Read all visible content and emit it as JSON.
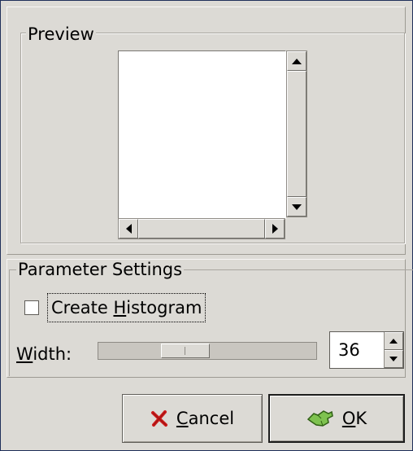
{
  "preview": {
    "legend": "Preview"
  },
  "parameters": {
    "legend": "Parameter Settings",
    "create_histogram": {
      "label_prefix": "Create ",
      "label_mnemonic": "H",
      "label_suffix": "istogram",
      "checked": false
    },
    "width": {
      "label_mnemonic": "W",
      "label_suffix": "idth:",
      "value": "36",
      "slider_fraction": 0.37
    }
  },
  "buttons": {
    "cancel": {
      "mnemonic": "C",
      "suffix": "ancel",
      "icon": "cancel-x-icon"
    },
    "ok": {
      "mnemonic": "O",
      "suffix": "K",
      "icon": "ok-hand-icon"
    }
  },
  "colors": {
    "window_bg": "#dcdad5",
    "canvas_bg": "#ffffff",
    "cancel_icon": "#cc1a1a",
    "ok_icon": "#5aa02c"
  }
}
